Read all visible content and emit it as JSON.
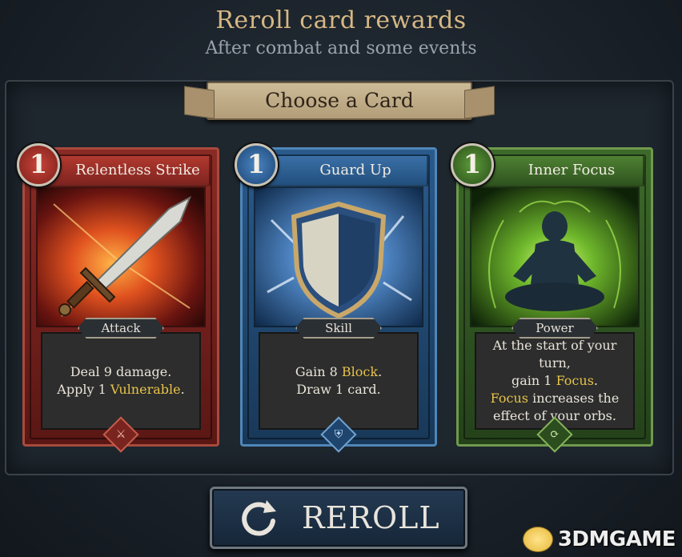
{
  "header": {
    "title": "Reroll card rewards",
    "subtitle": "After combat and some events"
  },
  "banner": {
    "label": "Choose a Card"
  },
  "cards": [
    {
      "name": "Relentless Strike",
      "cost": "1",
      "type": "Attack",
      "description": [
        [
          {
            "t": "Deal 9 damage."
          }
        ],
        [
          {
            "t": "Apply 1 "
          },
          {
            "t": "Vulnerable",
            "kw": true
          },
          {
            "t": "."
          }
        ]
      ],
      "color": "#8b2a24",
      "art_icon": "sword-icon",
      "gem_icon": "crossed-swords-icon"
    },
    {
      "name": "Guard Up",
      "cost": "1",
      "type": "Skill",
      "description": [
        [
          {
            "t": "Gain 8 "
          },
          {
            "t": "Block",
            "kw": true
          },
          {
            "t": "."
          }
        ],
        [
          {
            "t": "Draw 1 card."
          }
        ]
      ],
      "color": "#2a5a8c",
      "art_icon": "shield-icon",
      "gem_icon": "shield-icon"
    },
    {
      "name": "Inner Focus",
      "cost": "1",
      "type": "Power",
      "description": [
        [
          {
            "t": "At the start of your turn,"
          }
        ],
        [
          {
            "t": "gain 1 "
          },
          {
            "t": "Focus",
            "kw": true
          },
          {
            "t": "."
          }
        ],
        [
          {
            "t": "Focus",
            "kw": true
          },
          {
            "t": " increases the"
          }
        ],
        [
          {
            "t": "effect of your orbs."
          }
        ]
      ],
      "color": "#3d6a2a",
      "art_icon": "meditating-figure-icon",
      "gem_icon": "cycle-icon"
    }
  ],
  "reroll_button": {
    "label": "REROLL",
    "icon": "refresh-icon"
  },
  "watermark": {
    "text": "3DMGAME"
  },
  "colors": {
    "keyword": "#e8c24a",
    "title": "#d6b783",
    "background": "#1b232c"
  }
}
